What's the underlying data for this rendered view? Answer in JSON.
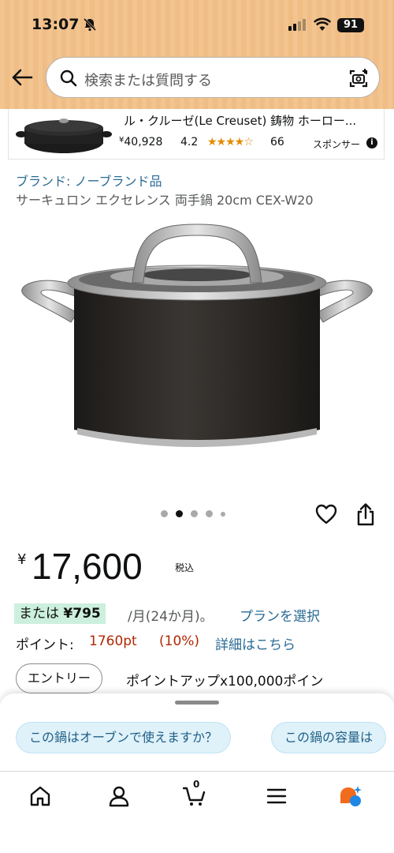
{
  "status_bar": {
    "time": "13:07",
    "battery": "91"
  },
  "search": {
    "placeholder": "検索または質問する"
  },
  "sponsored": {
    "title": "ル・クルーゼ(Le Creuset) 鋳物 ホーロー...",
    "price_symbol": "¥",
    "price": "40,928",
    "rating": "4.2",
    "stars": "★★★★☆",
    "review_count": "66",
    "label": "スポンサー",
    "info_glyph": "i"
  },
  "product": {
    "brand": "ブランド: ノーブランド品",
    "title": "サーキュロン エクセレンス 両手鍋 20cm CEX-W20",
    "image_count": 5,
    "image_index": 2,
    "price_symbol": "¥",
    "price": "17,600",
    "tax_label": "税込",
    "installment_prefix": "または ",
    "installment_amount": "¥795",
    "installment_suffix": " /月(24か月)。",
    "plan_link": "プランを選択",
    "points_label": "ポイント:",
    "points_value": "1760pt",
    "points_percent": "(10%)",
    "points_detail": "詳細はこちら",
    "entry_button": "エントリー",
    "entry_text": "ポイントアップx100,000ポイン"
  },
  "suggestions": [
    {
      "label": "この鍋はオーブンで使えますか？"
    },
    {
      "label": "この鍋の容量は"
    }
  ],
  "bottom_nav": {
    "cart_count": "0",
    "items": [
      "home-icon",
      "account-icon",
      "cart-icon",
      "menu-icon",
      "ai-assistant-icon"
    ]
  },
  "colors": {
    "header_bg": "#f2c48f",
    "link": "#2a6b94",
    "price_red": "#b12704",
    "installment_bg": "#ccf0dd",
    "chip_bg": "#dff1f9",
    "star": "#e38b00"
  }
}
